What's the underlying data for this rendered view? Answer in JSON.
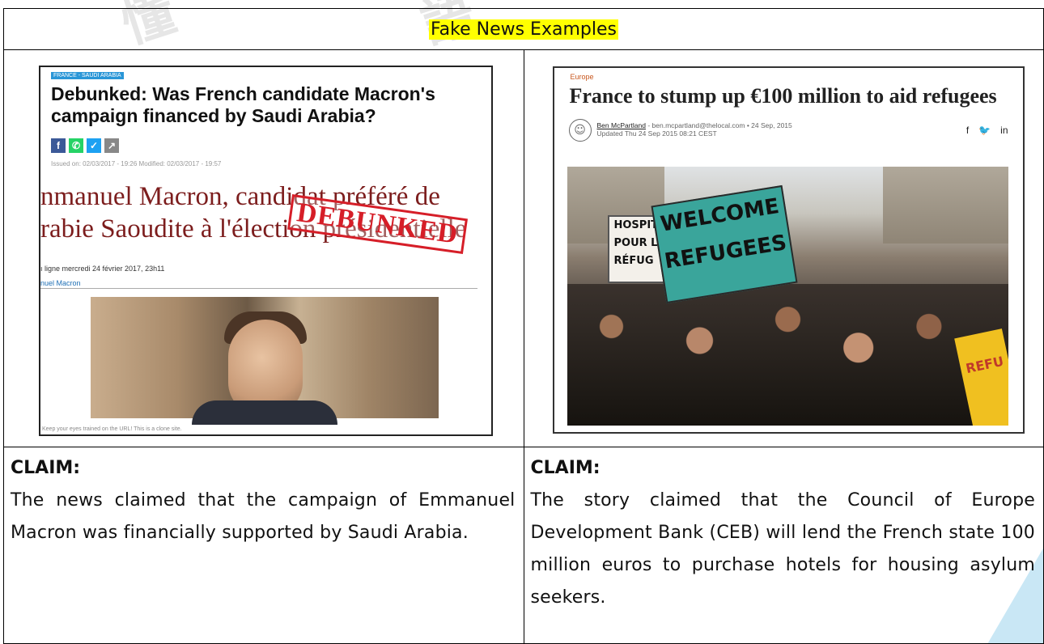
{
  "title": "Fake News Examples",
  "left": {
    "article": {
      "tag": "FRANCE - SAUDI ARABIA",
      "headline": "Debunked: Was French candidate Macron's campaign financed by Saudi Arabia?",
      "issued": "Issued on: 02/03/2017 - 19:26   Modified: 02/03/2017 - 19:57",
      "french_headline_line1": "nmanuel Macron, candidat préféré de",
      "french_headline_line2": "rabie Saoudite à l'élection présidentielle",
      "stamp": "DEBUNKED",
      "dateline": "ı ligne mercredi 24 février 2017, 23h11",
      "author": "nuel Macron",
      "caption": "Keep your eyes trained on the URL! This is a clone site."
    },
    "claim_label": "CLAIM:",
    "claim_text": "The news claimed that the campaign of Emmanuel Macron was financially supported by Saudi Arabia."
  },
  "right": {
    "article": {
      "category": "Europe",
      "headline": "France to stump up €100 million to aid refugees",
      "author_name": "Ben McPartland",
      "author_meta": " - ben.mcpartland@thelocal.com • 24 Sep, 2015",
      "updated": "Updated Thu 24 Sep 2015 08:21 CEST",
      "social": [
        "f",
        "🐦",
        "in"
      ],
      "sign_text": "WELCOME REFUGEES",
      "sign2_text": "HOSPIT POUR L RÉFUG",
      "sign3_text": "REFU"
    },
    "claim_label": "CLAIM:",
    "claim_text": "The story claimed that the Council of Europe Development Bank (CEB) will lend the French state 100 million euros to purchase hotels for housing asylum seekers."
  },
  "colors": {
    "highlight": "#ffff00",
    "stamp_red": "#d61e28",
    "tag_blue": "#2a96d7",
    "category_orange": "#c8571e",
    "sign_teal": "#3aa59b",
    "corner_blue": "#c9e7f5"
  }
}
